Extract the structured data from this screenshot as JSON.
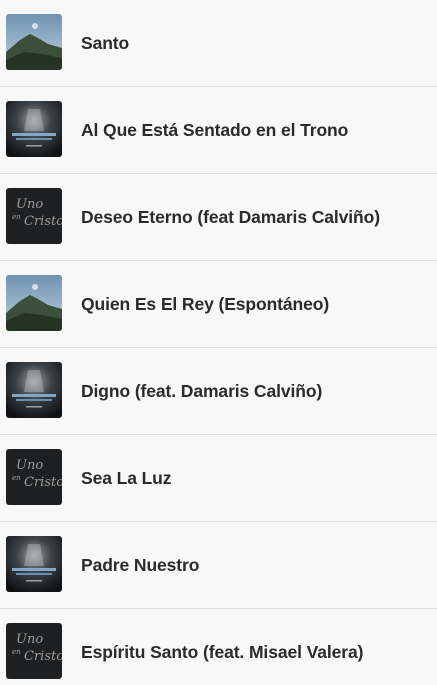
{
  "tracks": [
    {
      "title": "Santo",
      "cover": "mountain-landscape"
    },
    {
      "title": "Al Que Está Sentado en el Trono",
      "cover": "worship-live"
    },
    {
      "title": "Deseo Eterno (feat Damaris Calviño)",
      "cover": "uno-en-cristo"
    },
    {
      "title": "Quien Es El Rey (Espontáneo)",
      "cover": "mountain-landscape"
    },
    {
      "title": "Digno (feat. Damaris Calviño)",
      "cover": "worship-live"
    },
    {
      "title": "Sea La Luz",
      "cover": "uno-en-cristo"
    },
    {
      "title": "Padre Nuestro",
      "cover": "worship-live"
    },
    {
      "title": "Espíritu Santo (feat. Misael Valera)",
      "cover": "uno-en-cristo"
    }
  ],
  "covers": {
    "uno_en_cristo": {
      "line1": "Uno",
      "line2": "en",
      "line3": "Cristo"
    }
  },
  "colors": {
    "background": "#f8f8f8",
    "divider": "#dedede",
    "title_text": "#2b2b2b"
  }
}
